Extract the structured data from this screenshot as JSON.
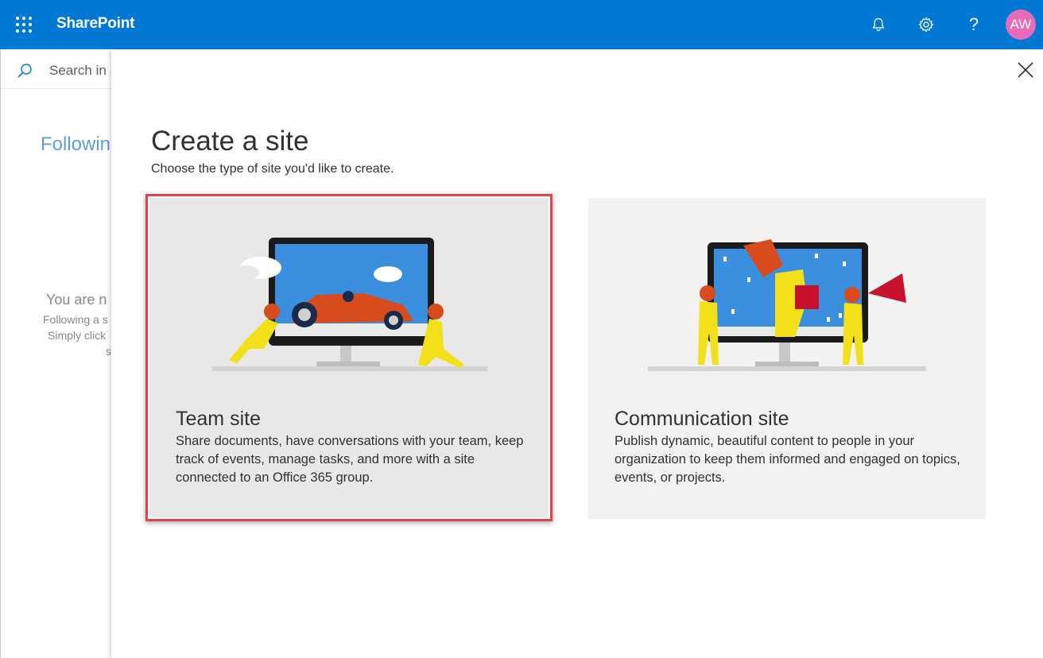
{
  "app": {
    "brand": "SharePoint",
    "avatar_initials": "AW"
  },
  "header_icons": [
    "bell-icon",
    "gear-icon",
    "help-icon"
  ],
  "header_help_glyph": "?",
  "background_page": {
    "search_placeholder": "Search in S",
    "following_heading": "Followin",
    "empty_title": "You are n",
    "empty_lines": [
      "Following a s",
      "Simply click",
      "s"
    ]
  },
  "panel": {
    "title": "Create a site",
    "subtitle": "Choose the type of site you'd like to create.",
    "cards": [
      {
        "title": "Team site",
        "description": "Share documents, have conversations with your team, keep track of events, manage tasks, and more with a site connected to an Office 365 group."
      },
      {
        "title": "Communication site",
        "description": "Publish dynamic, beautiful content to people in your organization to keep them informed and engaged on topics, events, or projects."
      }
    ]
  },
  "colors": {
    "suitebar": "#0078d4",
    "avatar": "#e76bb6",
    "highlight": "#e4434b"
  }
}
